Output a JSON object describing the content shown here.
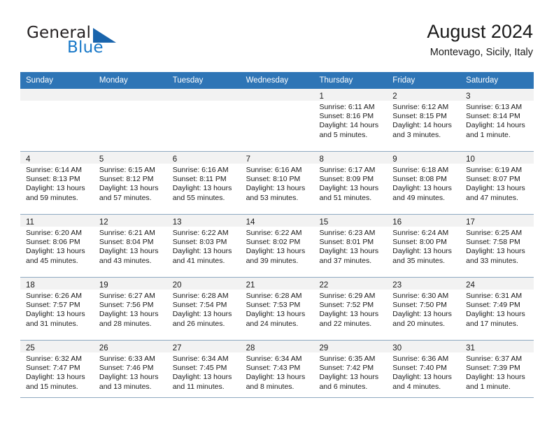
{
  "brand": {
    "name_part1": "General",
    "name_part2": "Blue",
    "accent_color": "#1964ac",
    "text_blue": "#1878c8"
  },
  "header": {
    "title": "August 2024",
    "subtitle": "Montevago, Sicily, Italy"
  },
  "calendar": {
    "header_bg": "#2e75b6",
    "grid_line": "#8ea9c1",
    "daynum_bg": "#f2f2f2",
    "weekdays": [
      "Sunday",
      "Monday",
      "Tuesday",
      "Wednesday",
      "Thursday",
      "Friday",
      "Saturday"
    ],
    "weeks": [
      [
        {
          "day": "",
          "sunrise": "",
          "sunset": "",
          "daylight1": "",
          "daylight2": ""
        },
        {
          "day": "",
          "sunrise": "",
          "sunset": "",
          "daylight1": "",
          "daylight2": ""
        },
        {
          "day": "",
          "sunrise": "",
          "sunset": "",
          "daylight1": "",
          "daylight2": ""
        },
        {
          "day": "",
          "sunrise": "",
          "sunset": "",
          "daylight1": "",
          "daylight2": ""
        },
        {
          "day": "1",
          "sunrise": "Sunrise: 6:11 AM",
          "sunset": "Sunset: 8:16 PM",
          "daylight1": "Daylight: 14 hours",
          "daylight2": "and 5 minutes."
        },
        {
          "day": "2",
          "sunrise": "Sunrise: 6:12 AM",
          "sunset": "Sunset: 8:15 PM",
          "daylight1": "Daylight: 14 hours",
          "daylight2": "and 3 minutes."
        },
        {
          "day": "3",
          "sunrise": "Sunrise: 6:13 AM",
          "sunset": "Sunset: 8:14 PM",
          "daylight1": "Daylight: 14 hours",
          "daylight2": "and 1 minute."
        }
      ],
      [
        {
          "day": "4",
          "sunrise": "Sunrise: 6:14 AM",
          "sunset": "Sunset: 8:13 PM",
          "daylight1": "Daylight: 13 hours",
          "daylight2": "and 59 minutes."
        },
        {
          "day": "5",
          "sunrise": "Sunrise: 6:15 AM",
          "sunset": "Sunset: 8:12 PM",
          "daylight1": "Daylight: 13 hours",
          "daylight2": "and 57 minutes."
        },
        {
          "day": "6",
          "sunrise": "Sunrise: 6:16 AM",
          "sunset": "Sunset: 8:11 PM",
          "daylight1": "Daylight: 13 hours",
          "daylight2": "and 55 minutes."
        },
        {
          "day": "7",
          "sunrise": "Sunrise: 6:16 AM",
          "sunset": "Sunset: 8:10 PM",
          "daylight1": "Daylight: 13 hours",
          "daylight2": "and 53 minutes."
        },
        {
          "day": "8",
          "sunrise": "Sunrise: 6:17 AM",
          "sunset": "Sunset: 8:09 PM",
          "daylight1": "Daylight: 13 hours",
          "daylight2": "and 51 minutes."
        },
        {
          "day": "9",
          "sunrise": "Sunrise: 6:18 AM",
          "sunset": "Sunset: 8:08 PM",
          "daylight1": "Daylight: 13 hours",
          "daylight2": "and 49 minutes."
        },
        {
          "day": "10",
          "sunrise": "Sunrise: 6:19 AM",
          "sunset": "Sunset: 8:07 PM",
          "daylight1": "Daylight: 13 hours",
          "daylight2": "and 47 minutes."
        }
      ],
      [
        {
          "day": "11",
          "sunrise": "Sunrise: 6:20 AM",
          "sunset": "Sunset: 8:06 PM",
          "daylight1": "Daylight: 13 hours",
          "daylight2": "and 45 minutes."
        },
        {
          "day": "12",
          "sunrise": "Sunrise: 6:21 AM",
          "sunset": "Sunset: 8:04 PM",
          "daylight1": "Daylight: 13 hours",
          "daylight2": "and 43 minutes."
        },
        {
          "day": "13",
          "sunrise": "Sunrise: 6:22 AM",
          "sunset": "Sunset: 8:03 PM",
          "daylight1": "Daylight: 13 hours",
          "daylight2": "and 41 minutes."
        },
        {
          "day": "14",
          "sunrise": "Sunrise: 6:22 AM",
          "sunset": "Sunset: 8:02 PM",
          "daylight1": "Daylight: 13 hours",
          "daylight2": "and 39 minutes."
        },
        {
          "day": "15",
          "sunrise": "Sunrise: 6:23 AM",
          "sunset": "Sunset: 8:01 PM",
          "daylight1": "Daylight: 13 hours",
          "daylight2": "and 37 minutes."
        },
        {
          "day": "16",
          "sunrise": "Sunrise: 6:24 AM",
          "sunset": "Sunset: 8:00 PM",
          "daylight1": "Daylight: 13 hours",
          "daylight2": "and 35 minutes."
        },
        {
          "day": "17",
          "sunrise": "Sunrise: 6:25 AM",
          "sunset": "Sunset: 7:58 PM",
          "daylight1": "Daylight: 13 hours",
          "daylight2": "and 33 minutes."
        }
      ],
      [
        {
          "day": "18",
          "sunrise": "Sunrise: 6:26 AM",
          "sunset": "Sunset: 7:57 PM",
          "daylight1": "Daylight: 13 hours",
          "daylight2": "and 31 minutes."
        },
        {
          "day": "19",
          "sunrise": "Sunrise: 6:27 AM",
          "sunset": "Sunset: 7:56 PM",
          "daylight1": "Daylight: 13 hours",
          "daylight2": "and 28 minutes."
        },
        {
          "day": "20",
          "sunrise": "Sunrise: 6:28 AM",
          "sunset": "Sunset: 7:54 PM",
          "daylight1": "Daylight: 13 hours",
          "daylight2": "and 26 minutes."
        },
        {
          "day": "21",
          "sunrise": "Sunrise: 6:28 AM",
          "sunset": "Sunset: 7:53 PM",
          "daylight1": "Daylight: 13 hours",
          "daylight2": "and 24 minutes."
        },
        {
          "day": "22",
          "sunrise": "Sunrise: 6:29 AM",
          "sunset": "Sunset: 7:52 PM",
          "daylight1": "Daylight: 13 hours",
          "daylight2": "and 22 minutes."
        },
        {
          "day": "23",
          "sunrise": "Sunrise: 6:30 AM",
          "sunset": "Sunset: 7:50 PM",
          "daylight1": "Daylight: 13 hours",
          "daylight2": "and 20 minutes."
        },
        {
          "day": "24",
          "sunrise": "Sunrise: 6:31 AM",
          "sunset": "Sunset: 7:49 PM",
          "daylight1": "Daylight: 13 hours",
          "daylight2": "and 17 minutes."
        }
      ],
      [
        {
          "day": "25",
          "sunrise": "Sunrise: 6:32 AM",
          "sunset": "Sunset: 7:47 PM",
          "daylight1": "Daylight: 13 hours",
          "daylight2": "and 15 minutes."
        },
        {
          "day": "26",
          "sunrise": "Sunrise: 6:33 AM",
          "sunset": "Sunset: 7:46 PM",
          "daylight1": "Daylight: 13 hours",
          "daylight2": "and 13 minutes."
        },
        {
          "day": "27",
          "sunrise": "Sunrise: 6:34 AM",
          "sunset": "Sunset: 7:45 PM",
          "daylight1": "Daylight: 13 hours",
          "daylight2": "and 11 minutes."
        },
        {
          "day": "28",
          "sunrise": "Sunrise: 6:34 AM",
          "sunset": "Sunset: 7:43 PM",
          "daylight1": "Daylight: 13 hours",
          "daylight2": "and 8 minutes."
        },
        {
          "day": "29",
          "sunrise": "Sunrise: 6:35 AM",
          "sunset": "Sunset: 7:42 PM",
          "daylight1": "Daylight: 13 hours",
          "daylight2": "and 6 minutes."
        },
        {
          "day": "30",
          "sunrise": "Sunrise: 6:36 AM",
          "sunset": "Sunset: 7:40 PM",
          "daylight1": "Daylight: 13 hours",
          "daylight2": "and 4 minutes."
        },
        {
          "day": "31",
          "sunrise": "Sunrise: 6:37 AM",
          "sunset": "Sunset: 7:39 PM",
          "daylight1": "Daylight: 13 hours",
          "daylight2": "and 1 minute."
        }
      ]
    ]
  }
}
